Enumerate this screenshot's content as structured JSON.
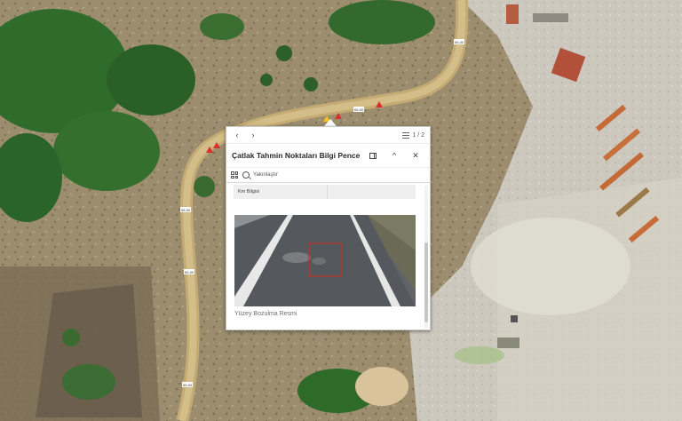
{
  "map": {
    "road_labels": [
      "65-00",
      "65-00",
      "65-00",
      "65-00",
      "65-00"
    ],
    "colors": {
      "road": "#c9b07a",
      "vegetation": "#2e6a2a",
      "bare_ground": "#a89a7c",
      "marker": "#d8302a"
    }
  },
  "popup": {
    "pagination": "1 / 2",
    "title": "Çatlak Tahmin Noktaları Bilgi Penceresi",
    "zoom_action_label": "Yakınlaştır",
    "attribute_key": "Km Bilgisi",
    "attribute_value": "",
    "image_caption": "Yüzey Bozulma Resmi",
    "icons": {
      "prev": "chevron-left-icon",
      "next": "chevron-right-icon",
      "list": "list-icon",
      "dock": "dock-icon",
      "collapse": "chevron-up-icon",
      "close": "close-icon",
      "actions": "grid-icon",
      "zoom": "zoom-in-icon"
    }
  }
}
